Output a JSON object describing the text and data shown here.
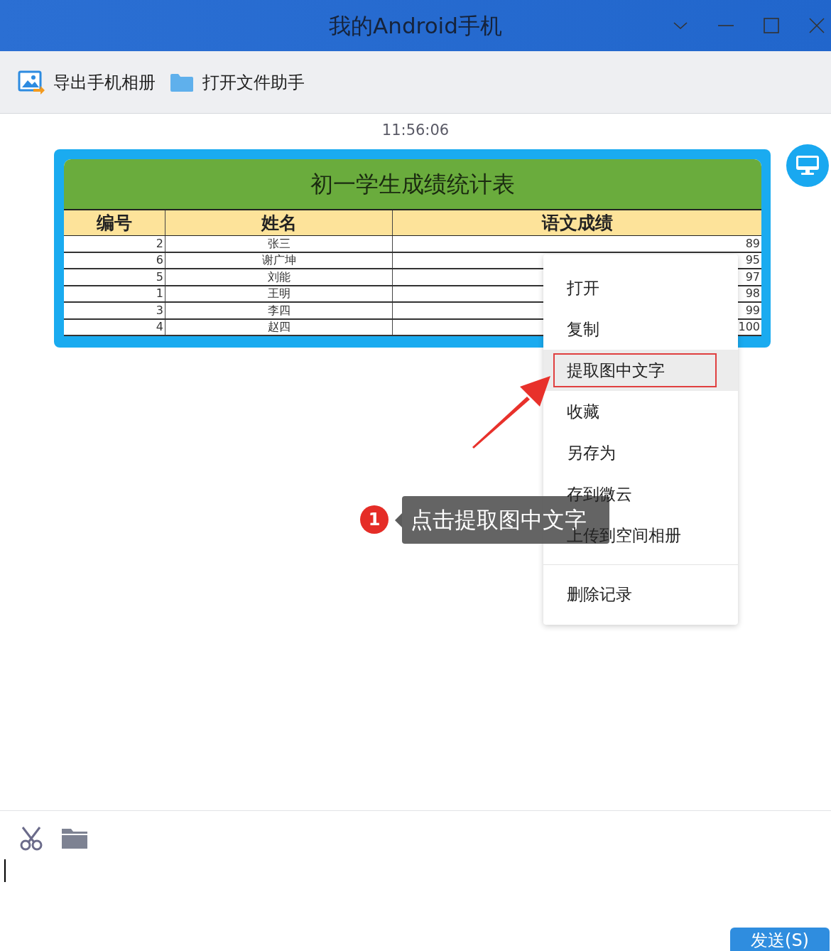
{
  "window": {
    "title": "我的Android手机"
  },
  "toolbar": [
    {
      "label": "导出手机相册",
      "kind": "photo"
    },
    {
      "label": "打开文件助手",
      "kind": "folder"
    }
  ],
  "timestamp": "11:56:06",
  "message": {
    "table": {
      "title": "初一学生成绩统计表",
      "columns": [
        "编号",
        "姓名",
        "语文成绩"
      ],
      "rows": [
        [
          "2",
          "张三",
          "89"
        ],
        [
          "6",
          "谢广坤",
          "95"
        ],
        [
          "5",
          "刘能",
          "97"
        ],
        [
          "1",
          "王明",
          "98"
        ],
        [
          "3",
          "李四",
          "99"
        ],
        [
          "4",
          "赵四",
          "100"
        ]
      ]
    }
  },
  "context_menu": {
    "groups": [
      [
        {
          "label": "打开",
          "selected": false
        },
        {
          "label": "复制",
          "selected": false
        },
        {
          "label": "提取图中文字",
          "selected": true
        },
        {
          "label": "收藏",
          "selected": false
        },
        {
          "label": "另存为",
          "selected": false
        },
        {
          "label": "存到微云",
          "selected": false
        },
        {
          "label": "上传到空间相册",
          "selected": false
        }
      ],
      [
        {
          "label": "删除记录",
          "selected": false
        }
      ]
    ]
  },
  "callout": {
    "badge": "1",
    "text": "点击提取图中文字"
  },
  "compose": {
    "send_button": "发送(S)"
  }
}
